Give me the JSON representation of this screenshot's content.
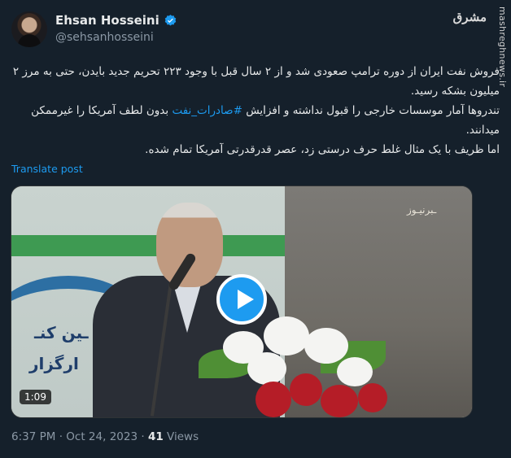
{
  "author": {
    "name": "Ehsan Hosseini",
    "handle": "@sehsanhosseini",
    "verified": true
  },
  "watermark": {
    "logo_text": "مشرق",
    "site": "mashreghnews.ir"
  },
  "tweet": {
    "lines": [
      "فروش نفت ایران از دوره ترامپ صعودی شد و از ۲ سال قبل با وجود ۲۲۳ تحریم جدید بایدن، حتی به مرز ۲ میلیون بشکه رسید.",
      "تندروها آمار موسسات خارجی را قبول نداشته و افزایش",
      "بدون لطف آمریکا را غیرممکن میدانند.",
      "اما ظریف با یک مثال غلط حرف درستی زد، عصر قدرقدرتی آمریکا تمام شده."
    ],
    "hashtag": "#صادرات_نفت",
    "translate_label": "Translate post"
  },
  "video": {
    "duration": "1:09",
    "banner_line1": "ـین کنـ",
    "banner_line2": "ارگزار",
    "corner_logo": "ـبرنیـوز"
  },
  "meta": {
    "time": "6:37 PM",
    "separator": "·",
    "date": "Oct 24, 2023",
    "views_count": "41",
    "views_label": "Views"
  },
  "colors": {
    "background": "#15202b",
    "text": "#e7e9ea",
    "muted": "#8b98a5",
    "accent": "#1d9bf0"
  }
}
